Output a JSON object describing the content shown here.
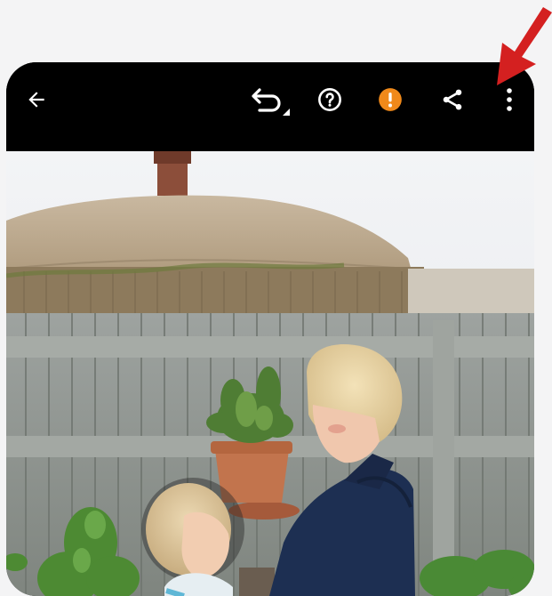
{
  "toolbar": {
    "icons": {
      "back": "arrow-back-icon",
      "undo": "undo-icon",
      "help": "help-icon",
      "warning": "warning-icon",
      "share": "share-icon",
      "more": "more-vert-icon"
    }
  },
  "annotation": {
    "arrow_color": "#d42020",
    "points_to": "more-options-button"
  },
  "colors": {
    "toolbar_bg": "#000000",
    "icon": "#ffffff",
    "warning": "#f0891a",
    "page_bg": "#f4f4f5"
  },
  "photo": {
    "description_icon": "photo-image"
  }
}
